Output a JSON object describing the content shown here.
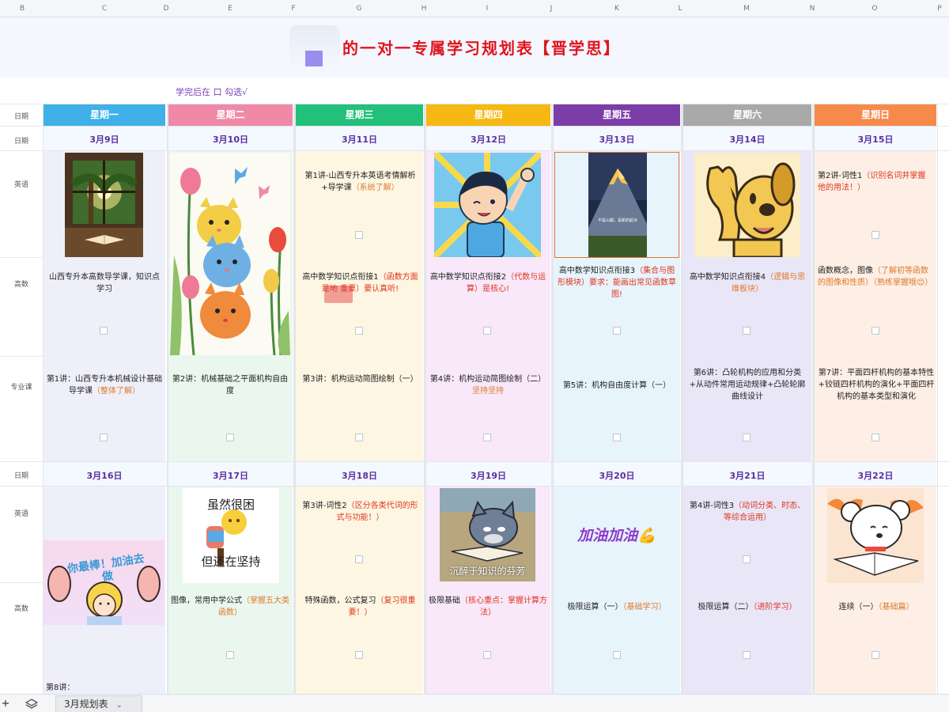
{
  "column_letters": [
    "B",
    "C",
    "D",
    "E",
    "F",
    "G",
    "H",
    "I",
    "J",
    "K",
    "L",
    "M",
    "N",
    "O",
    "P"
  ],
  "title": "的一对一专属学习规划表【晋学思】",
  "note": "学完后在 口 勾选√",
  "row_labels": {
    "date": "日期",
    "english": "英语",
    "math": "高数",
    "major": "专业课"
  },
  "weekdays": [
    {
      "label": "星期一",
      "color": "#3fb0e8"
    },
    {
      "label": "星期二",
      "color": "#ef89a7"
    },
    {
      "label": "星期三",
      "color": "#22c07a"
    },
    {
      "label": "星期四",
      "color": "#f6b812"
    },
    {
      "label": "星期五",
      "color": "#7b3ea8"
    },
    {
      "label": "星期六",
      "color": "#a9a9a9"
    },
    {
      "label": "星期日",
      "color": "#f7894a"
    }
  ],
  "week1_dates": [
    "3月9日",
    "3月10日",
    "3月11日",
    "3月12日",
    "3月13日",
    "3月14日",
    "3月15日"
  ],
  "week2_dates": [
    "3月16日",
    "3月17日",
    "3月18日",
    "3月19日",
    "3月20日",
    "3月21日",
    "3月22日"
  ],
  "week1": {
    "english": {
      "wed": {
        "main": "第1讲-山西专升本英语考情解析+导学课",
        "hint": "（系统了解）"
      },
      "sun": {
        "main": "第2讲-词性1",
        "hint": "（识别名词并掌握他的用法！）"
      }
    },
    "math": {
      "mon": {
        "main": "山西专升本高数导学课，知识点学习",
        "hint": ""
      },
      "wed": {
        "main": "高中数学知识点衔接1",
        "hint": "（函数方面是地  重要）要认真听!"
      },
      "thu": {
        "main": "高中数学知识点衔接2",
        "hint": "（代数与运算）是核心!"
      },
      "fri": {
        "main": "高中数学知识点衔接3",
        "hint": "（集合与图形模块）要求：能画出常见函数草图!"
      },
      "sat": {
        "main": "高中数学知识点衔接4",
        "hint": "（逻辑与思维板块）"
      },
      "sun": {
        "main": "函数概念，图像",
        "hint": "（了解初等函数的图像和性质）（熟练掌握哦😊）"
      }
    },
    "major": {
      "mon": {
        "main": "第1讲：山西专升本机械设计基础导学课",
        "hint": "（整体了解）"
      },
      "tue": {
        "main": "第2讲：机械基础之平面机构自由度",
        "hint": ""
      },
      "wed": {
        "main": "第3讲：机构运动简图绘制（一）",
        "hint": ""
      },
      "thu": {
        "main": "第4讲：机构运动简图绘制（二）",
        "hint": "坚持坚持"
      },
      "fri": {
        "main": "第5讲：机构自由度计算（一）",
        "hint": ""
      },
      "sat": {
        "main": "第6讲：凸轮机构的应用和分类+从动件常用运动规律+凸轮轮廓曲线设计",
        "hint": ""
      },
      "sun": {
        "main": "第7讲：平面四杆机构的基本特性+铰链四杆机构的演化+平面四杆机构的基本类型和演化",
        "hint": ""
      }
    }
  },
  "week2": {
    "english": {
      "wed": {
        "main": "第3讲-词性2",
        "hint": "（区分各类代词的形式与功能！）"
      },
      "sat": {
        "main": "第4讲-词性3",
        "hint": "（动词分类、时态、等综合运用）"
      }
    },
    "math": {
      "tue": {
        "main": "图像，常用中学公式",
        "hint": "（掌握五大类函数）"
      },
      "wed": {
        "main": "特殊函数，公式复习",
        "hint": "（复习很重要！）"
      },
      "thu": {
        "main": "极限基础",
        "hint": "（核心重点：掌握计算方法）"
      },
      "fri": {
        "main": "极限运算（一）",
        "hint": "（基础学习）"
      },
      "sat": {
        "main": "极限运算（二）",
        "hint": "（进阶学习）"
      },
      "sun": {
        "main": "连续（一）",
        "hint": "（基础篇）"
      }
    },
    "major": {
      "mon": {
        "main": "第8讲：",
        "hint": ""
      }
    }
  },
  "images": {
    "tue_w2_caption_top": "虽然很困",
    "tue_w2_caption_bottom": "但还在坚持",
    "thu_w2_caption": "沉醉于知识的芬芳",
    "fri_w2_text": "加油加油💪",
    "mon_w2_text": "你最棒！加油去做",
    "fri_w1_overlay": "不是山巅，是新的起点"
  },
  "bottom": {
    "sheet_tab": "3月规划表",
    "tab_arrow": "⌄"
  }
}
